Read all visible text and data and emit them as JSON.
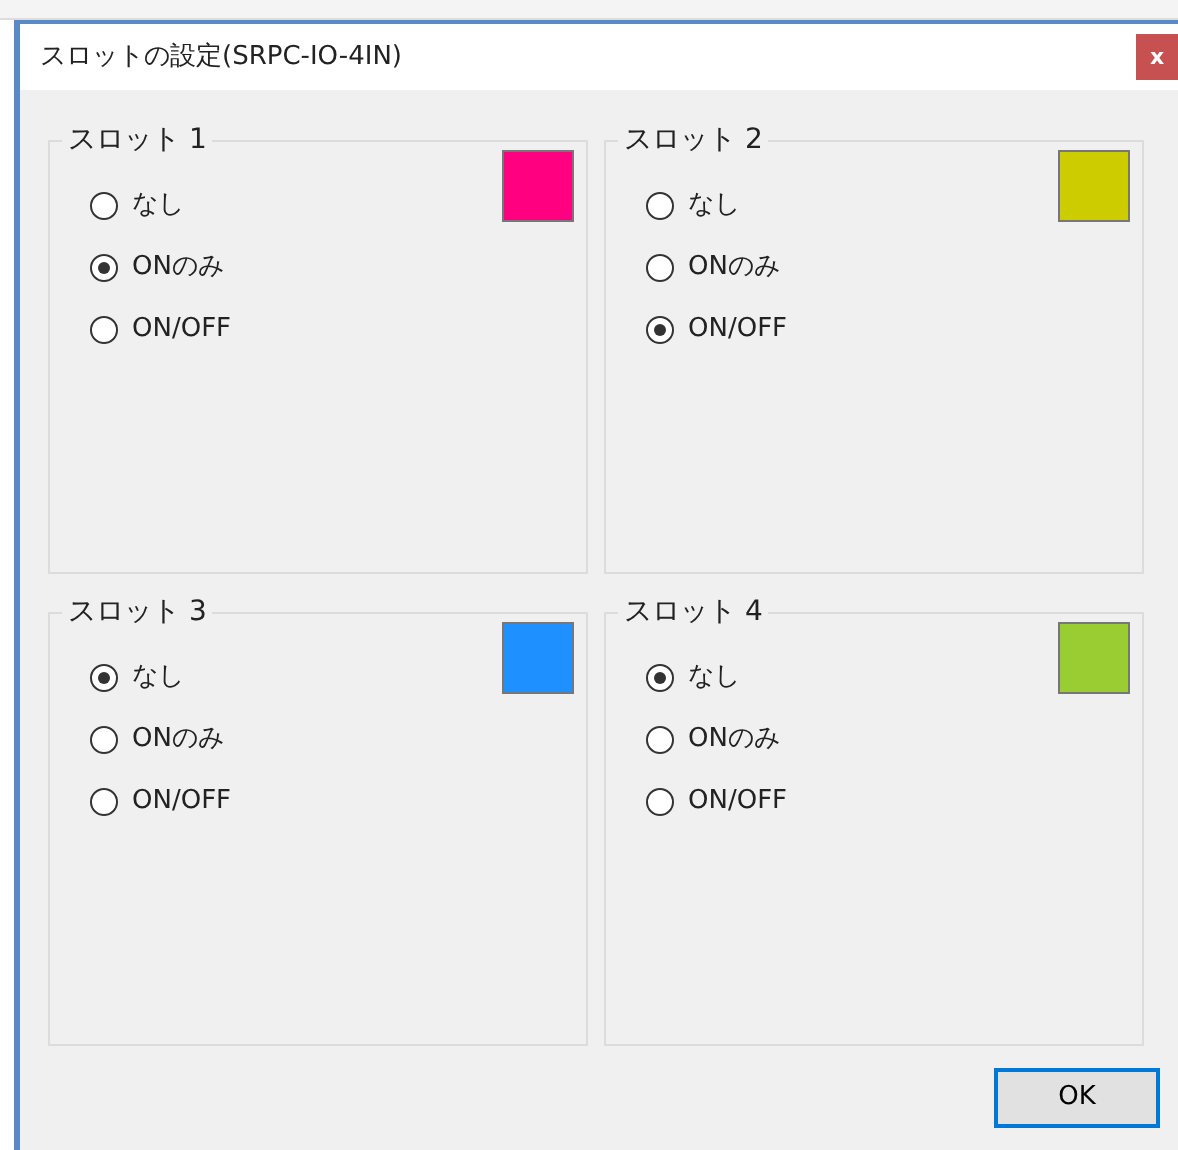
{
  "window": {
    "title": "スロットの設定(SRPC-IO-4IN)",
    "close_label": "x"
  },
  "slots": [
    {
      "title": "スロット 1",
      "color": "#ff0080",
      "options": [
        {
          "label": "なし",
          "selected": false
        },
        {
          "label": "ONのみ",
          "selected": true
        },
        {
          "label": "ON/OFF",
          "selected": false
        }
      ]
    },
    {
      "title": "スロット 2",
      "color": "#cccc00",
      "options": [
        {
          "label": "なし",
          "selected": false
        },
        {
          "label": "ONのみ",
          "selected": false
        },
        {
          "label": "ON/OFF",
          "selected": true
        }
      ]
    },
    {
      "title": "スロット 3",
      "color": "#1e90ff",
      "options": [
        {
          "label": "なし",
          "selected": true
        },
        {
          "label": "ONのみ",
          "selected": false
        },
        {
          "label": "ON/OFF",
          "selected": false
        }
      ]
    },
    {
      "title": "スロット 4",
      "color": "#9acd32",
      "options": [
        {
          "label": "なし",
          "selected": true
        },
        {
          "label": "ONのみ",
          "selected": false
        },
        {
          "label": "ON/OFF",
          "selected": false
        }
      ]
    }
  ],
  "ok_button": {
    "label": "OK",
    "default": true
  }
}
